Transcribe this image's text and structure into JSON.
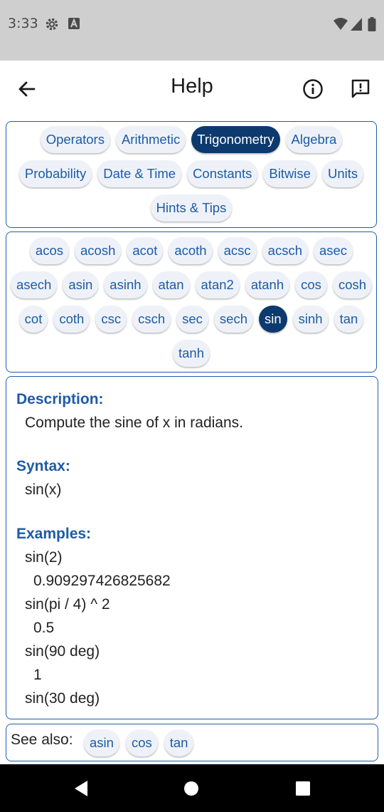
{
  "status_bar": {
    "time": "3:33",
    "icons": [
      "settings-icon",
      "a-notification-icon",
      "wifi-icon",
      "signal-icon",
      "battery-icon"
    ]
  },
  "app_bar": {
    "title": "Help",
    "back_icon": "back-arrow-icon",
    "info_icon": "info-icon",
    "feedback_icon": "feedback-icon"
  },
  "categories": {
    "rows": [
      [
        "Operators",
        "Arithmetic",
        "Trigonometry",
        "Algebra"
      ],
      [
        "Probability",
        "Date & Time",
        "Constants",
        "Bitwise",
        "Units"
      ],
      [
        "Hints & Tips"
      ]
    ],
    "selected": "Trigonometry"
  },
  "functions": {
    "rows": [
      [
        "acos",
        "acosh",
        "acot",
        "acoth",
        "acsc",
        "acsch",
        "asec"
      ],
      [
        "asech",
        "asin",
        "asinh",
        "atan",
        "atan2",
        "atanh",
        "cos",
        "cosh"
      ],
      [
        "cot",
        "coth",
        "csc",
        "csch",
        "sec",
        "sech",
        "sin",
        "sinh",
        "tan"
      ],
      [
        "tanh"
      ]
    ],
    "selected": "sin"
  },
  "detail": {
    "description_heading": "Description:",
    "description_text": "Compute the sine of x in radians.",
    "syntax_heading": "Syntax:",
    "syntax_text": "sin(x)",
    "examples_heading": "Examples:",
    "examples": [
      {
        "expr": "sin(2)",
        "result": "0.909297426825682"
      },
      {
        "expr": "sin(pi / 4) ^ 2",
        "result": "0.5"
      },
      {
        "expr": "sin(90 deg)",
        "result": "1"
      },
      {
        "expr": "sin(30 deg)",
        "result": ""
      }
    ]
  },
  "see_also": {
    "label": "See also:",
    "items": [
      "asin",
      "cos",
      "tan"
    ]
  },
  "colors": {
    "accent": "#1e5ba6",
    "chip_selected_bg": "#0d3a6e",
    "chip_bg": "#eef2f8",
    "status_bar_bg": "#cfcfcf"
  }
}
